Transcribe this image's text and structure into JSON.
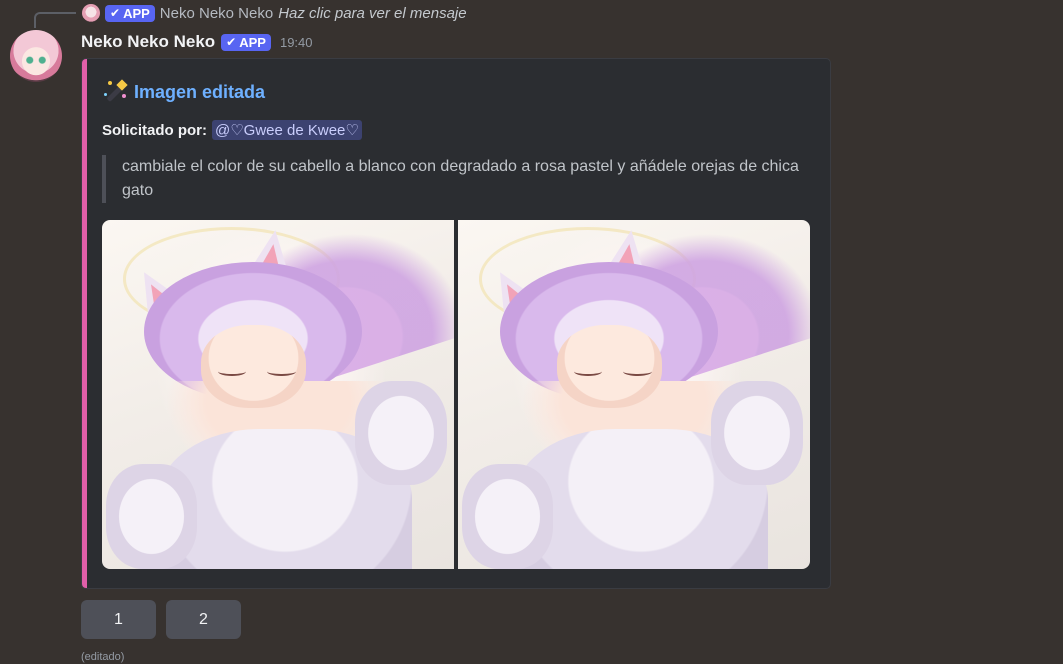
{
  "reply": {
    "badge": "APP",
    "author": "Neko Neko Neko",
    "preview": "Haz clic para ver el mensaje"
  },
  "message": {
    "author": "Neko Neko Neko",
    "badge": "APP",
    "timestamp": "19:40",
    "edited_label": "(editado)"
  },
  "embed": {
    "accent_color": "#e05fa9",
    "title_icon": "magic-wand-icon",
    "title": "Imagen editada",
    "requested_label": "Solicitado por:",
    "mention": "@♡Gwee de Kwee♡",
    "prompt": "cambiale el color de su cabello a blanco con degradado a rosa pastel y añádele orejas de chica gato",
    "images": [
      "image-1",
      "image-2"
    ]
  },
  "buttons": [
    "1",
    "2"
  ]
}
